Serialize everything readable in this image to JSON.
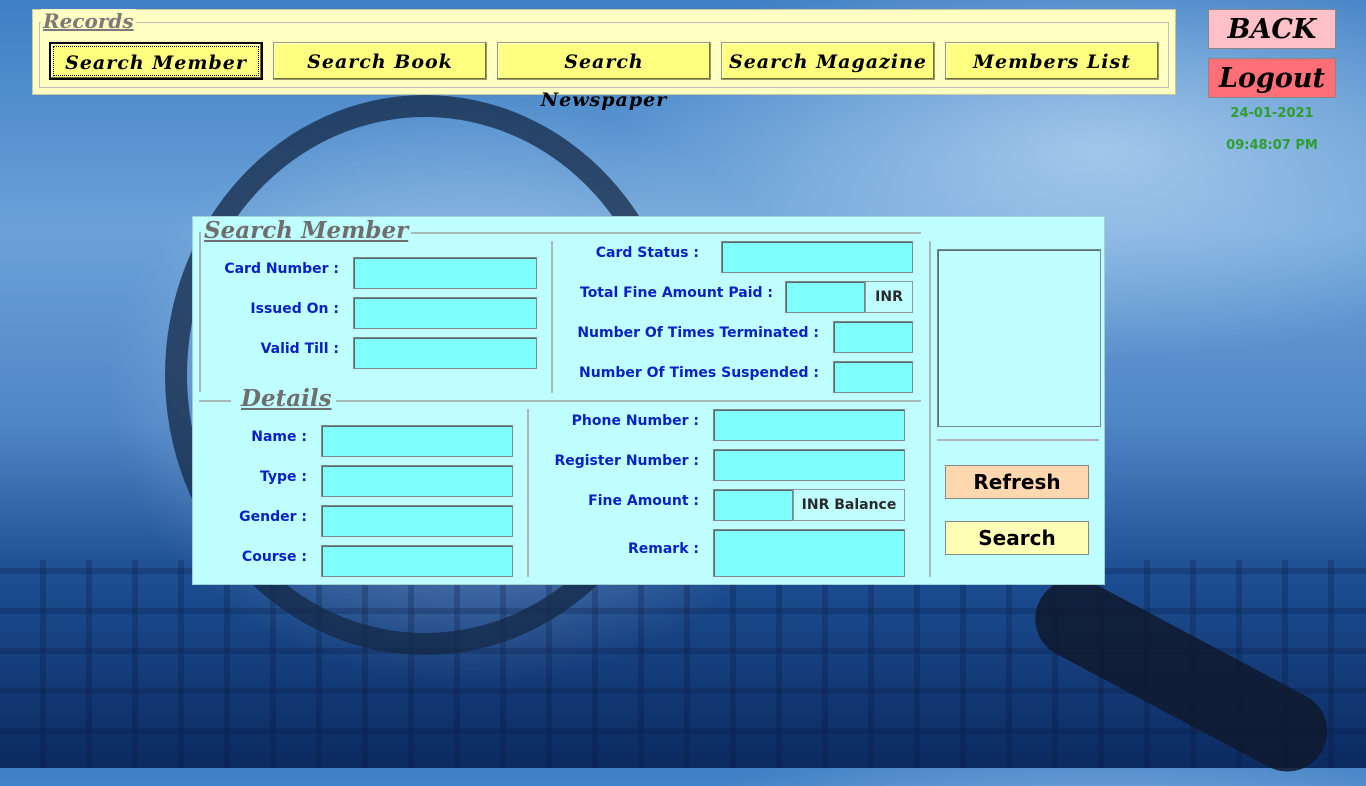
{
  "records": {
    "title": "Records",
    "buttons": [
      "Search Member",
      "Search Book",
      "Search Newspaper",
      "Search Magazine",
      "Members List"
    ],
    "active_index": 0
  },
  "header": {
    "back_label": "BACK",
    "logout_label": "Logout",
    "date": "24-01-2021",
    "time": "09:48:07 PM"
  },
  "search_member": {
    "title": "Search Member",
    "card_number_label": "Card Number :",
    "issued_on_label": "Issued On :",
    "valid_till_label": "Valid Till :",
    "card_status_label": "Card Status :",
    "total_fine_label": "Total Fine Amount Paid :",
    "total_fine_unit": "INR",
    "times_terminated_label": "Number Of Times Terminated :",
    "times_suspended_label": "Number Of Times Suspended :",
    "values": {
      "card_number": "",
      "issued_on": "",
      "valid_till": "",
      "card_status": "",
      "total_fine": "",
      "times_terminated": "",
      "times_suspended": ""
    }
  },
  "details": {
    "title": "Details",
    "name_label": "Name :",
    "type_label": "Type :",
    "gender_label": "Gender :",
    "course_label": "Course :",
    "phone_label": "Phone Number :",
    "register_label": "Register Number :",
    "fine_label": "Fine Amount :",
    "fine_unit": "INR Balance",
    "remark_label": "Remark :",
    "values": {
      "name": "",
      "type": "",
      "gender": "",
      "course": "",
      "phone": "",
      "register": "",
      "fine": "",
      "remark": ""
    }
  },
  "actions": {
    "refresh_label": "Refresh",
    "search_label": "Search"
  },
  "colors": {
    "records_bg": "#ffffc4",
    "button_yellow": "#ffff80",
    "panel_bg": "#c0ffff",
    "field_bg": "#80ffff",
    "label_blue": "#0a20c0",
    "back_pink": "#ffc0c8",
    "logout_red": "#ff6f78",
    "clock_green": "#2e9e2e"
  }
}
